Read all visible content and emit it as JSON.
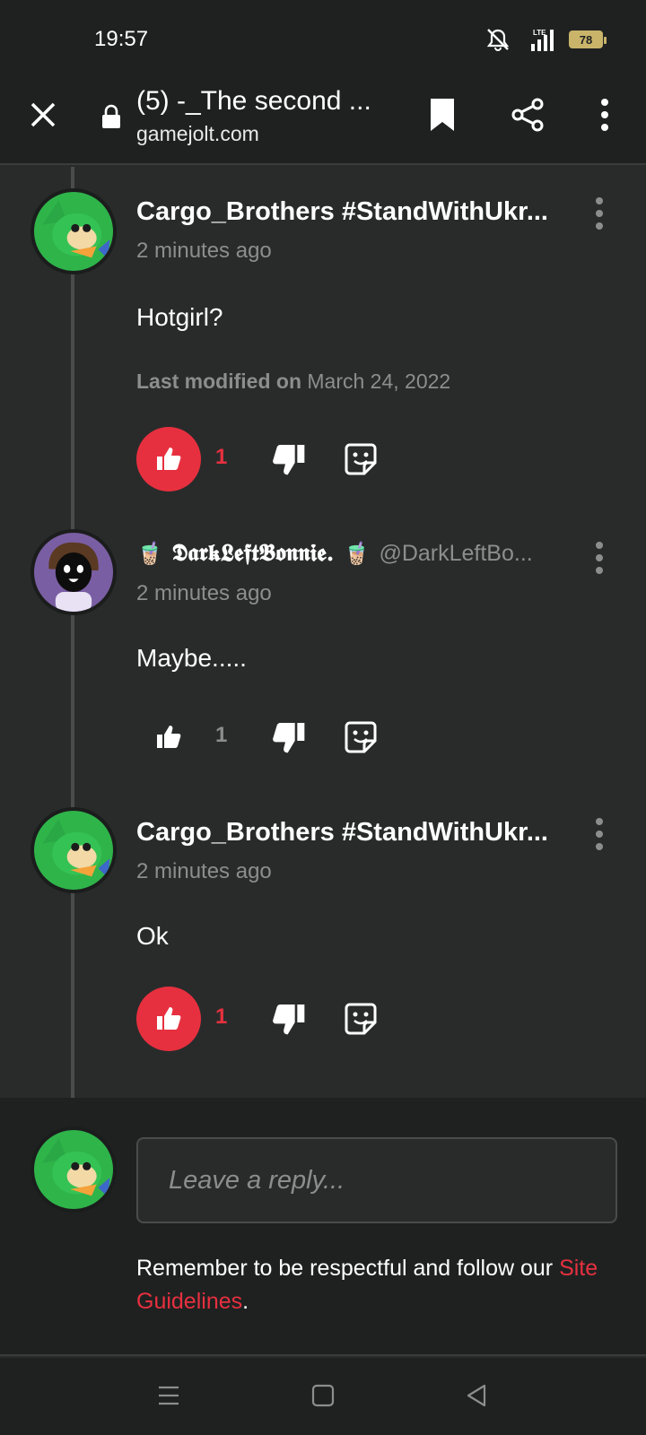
{
  "status_bar": {
    "time": "19:57",
    "battery": "78"
  },
  "browser": {
    "title": "(5) -_The second ...",
    "url": "gamejolt.com"
  },
  "comments": [
    {
      "author": "Cargo_Brothers #StandWithUkr...",
      "time": "2 minutes ago",
      "body": "Hotgirl?",
      "modified_label": "Last modified on",
      "modified_date": "March 24, 2022",
      "likes": "1",
      "liked": true
    },
    {
      "author_prefix": "🧋",
      "author": "𝕯𝖆𝖗𝖐𝕷𝖊𝖋𝖙𝕭𝖔𝖓𝖓𝖎𝖊.",
      "author_suffix": "🧋",
      "handle": "@DarkLeftBo...",
      "time": "2 minutes ago",
      "body": "Maybe.....",
      "likes": "1",
      "liked": false
    },
    {
      "author": "Cargo_Brothers #StandWithUkr...",
      "time": "2 minutes ago",
      "body": "Ok",
      "likes": "1",
      "liked": true
    }
  ],
  "reply": {
    "placeholder": "Leave a reply...",
    "note": "Remember to be respectful and follow our ",
    "link": "Site Guidelines",
    "note_end": "."
  },
  "colors": {
    "accent": "#e7303f",
    "background": "#292b2b",
    "toolbar": "#1f2121",
    "muted": "#8c8e8e"
  }
}
